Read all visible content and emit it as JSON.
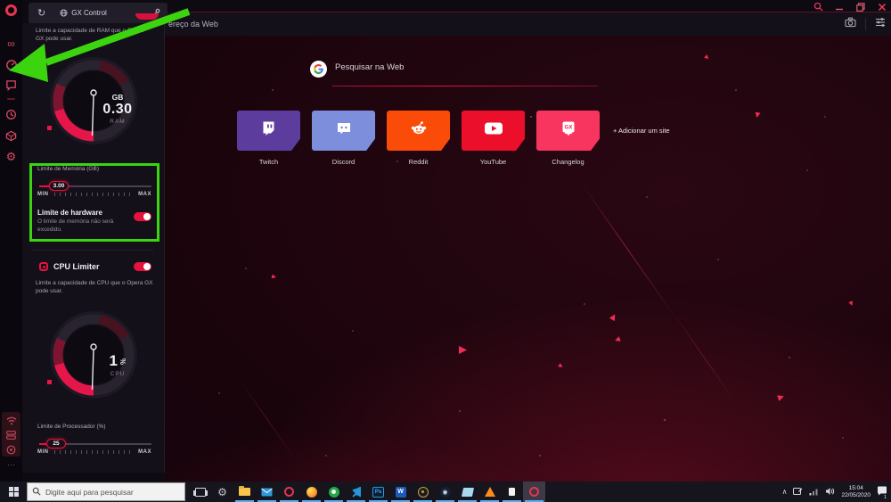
{
  "theme": {
    "accent_red": "#e3133e",
    "annotation_green": "#3bd40f",
    "taskbar_run_indicator": "#55aef2"
  },
  "browser": {
    "tab": {
      "title": "GX Control"
    },
    "address_bar": {
      "visible_text": "ereço da Web"
    }
  },
  "icons": {
    "gx_corner_glyph": "∞",
    "settings_glyph": "⚙",
    "sidebar_more_glyph": "⋯",
    "reload_glyph": "↻",
    "steam_glyph": "◉",
    "tray_chevron_glyph": "∧"
  },
  "gx_panel": {
    "ram": {
      "description": "Limite a capacidade de RAM que o Opera GX pode usar.",
      "gauge": {
        "value": "0.30",
        "unit": "GB",
        "label": "RAM"
      },
      "memory_limit_label": "Limite de Memória (GB)",
      "memory_limit_value": "3.00",
      "min": "MIN",
      "max": "MAX",
      "hardware_limit_title": "Limite de hardware",
      "hardware_limit_desc_line1": "O limite de memória não será",
      "hardware_limit_desc_line2": "excedido.",
      "hardware_limit_enabled": true
    },
    "cpu": {
      "title": "CPU Limiter",
      "enabled": true,
      "description": "Limite a capacidade de CPU que o Opera GX pode usar.",
      "gauge": {
        "value": "1",
        "unit": "%",
        "label": "CPU"
      },
      "processor_limit_label": "Limite de Processador (%)",
      "processor_limit_value": "25",
      "min": "MIN",
      "max": "MAX"
    }
  },
  "speed_dial": {
    "search_placeholder": "Pesquisar na Web",
    "tiles": [
      {
        "label": "Twitch",
        "color": "#5c3d9e"
      },
      {
        "label": "Discord",
        "color": "#7d8fdc"
      },
      {
        "label": "Reddit",
        "color": "#fb4b09"
      },
      {
        "label": "YouTube",
        "color": "#ec0f2b"
      },
      {
        "label": "Changelog",
        "color": "#f8355e"
      }
    ],
    "add_site_label": "+ Adicionar um site"
  },
  "taskbar": {
    "search_placeholder": "Digite aqui para pesquisar",
    "tray": {
      "time": "15:04",
      "date": "22/05/2020",
      "notification_count": "1"
    }
  }
}
